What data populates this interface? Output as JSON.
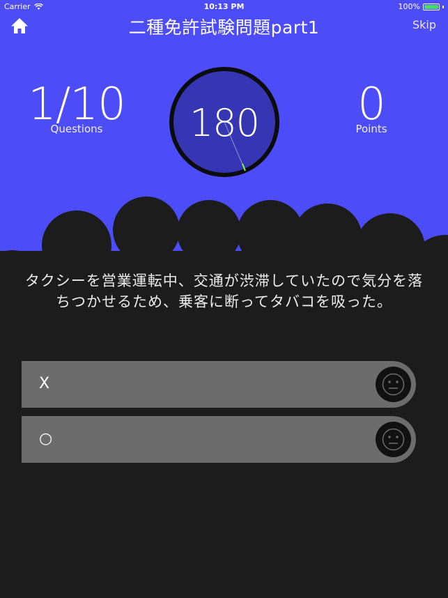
{
  "status_bar": {
    "carrier": "Carrier",
    "time": "10:13 PM",
    "battery": "100%"
  },
  "header": {
    "title": "二種免許試験問題part1",
    "home_icon": "home-icon",
    "skip_label": "Skip"
  },
  "stats": {
    "question_progress": "1/10",
    "question_label": "Questions",
    "timer_value": "180",
    "points_value": "0",
    "points_label": "Points"
  },
  "question_text": "タクシーを営業運転中、交通が渋滞していたので気分を落ちつかせるため、乗客に断ってタバコを吸った。",
  "answers": [
    {
      "label": "X",
      "icon": "neutral-face-icon"
    },
    {
      "label": "○",
      "icon": "neutral-face-icon"
    }
  ],
  "colors": {
    "header_background": "#4c4cf8",
    "timer_fill": "#3636b4",
    "cloud_background": "#1c1c1c",
    "answer_background": "#6c6c6c",
    "timer_needle": "#7cff4a"
  }
}
